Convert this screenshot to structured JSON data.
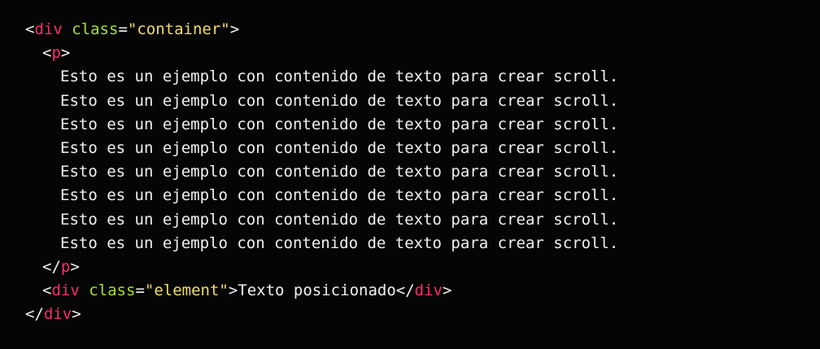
{
  "colors": {
    "background": "#050505",
    "tag": "#ff2b6d",
    "attribute": "#a6e22e",
    "string": "#f2dc6b",
    "text": "#f1f1f1"
  },
  "code": {
    "open_bracket": "<",
    "close_bracket": ">",
    "open_end_bracket": "</",
    "equals": "=",
    "container_tag": "div",
    "container_attr": "class",
    "container_value": "\"container\"",
    "p_tag": "p",
    "text_lines": [
      "Esto es un ejemplo con contenido de texto para crear scroll.",
      "Esto es un ejemplo con contenido de texto para crear scroll.",
      "Esto es un ejemplo con contenido de texto para crear scroll.",
      "Esto es un ejemplo con contenido de texto para crear scroll.",
      "Esto es un ejemplo con contenido de texto para crear scroll.",
      "Esto es un ejemplo con contenido de texto para crear scroll.",
      "Esto es un ejemplo con contenido de texto para crear scroll.",
      "Esto es un ejemplo con contenido de texto para crear scroll."
    ],
    "element_tag": "div",
    "element_attr": "class",
    "element_value": "\"element\"",
    "element_text": "Texto posicionado"
  }
}
